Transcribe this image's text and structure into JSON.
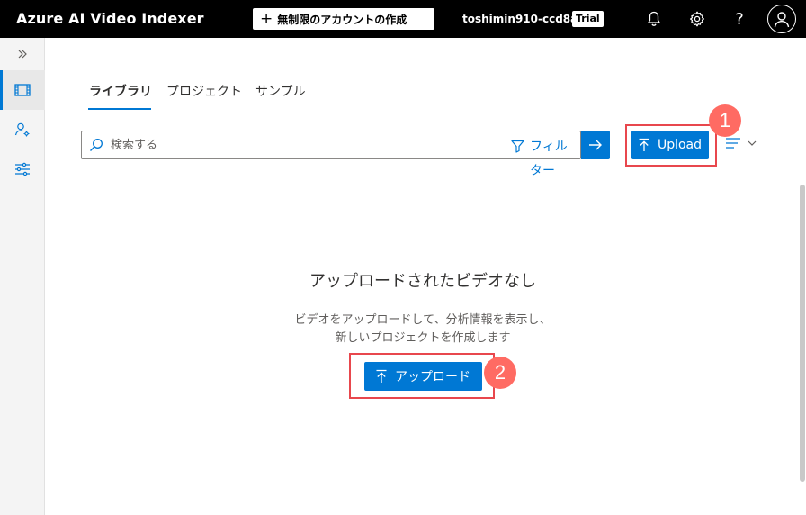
{
  "header": {
    "app_title": "Azure AI Video Indexer",
    "create_account_label": "無制限のアカウントの作成",
    "account_name": "toshimin910-ccd8ab",
    "trial_badge": "Trial",
    "icons": [
      "bell-icon",
      "gear-icon",
      "help-icon",
      "user-icon"
    ]
  },
  "sidebar": {
    "items": [
      {
        "name": "library",
        "icon": "film-icon",
        "active": true
      },
      {
        "name": "people",
        "icon": "people-settings-icon",
        "active": false
      },
      {
        "name": "customize",
        "icon": "sliders-icon",
        "active": false
      }
    ]
  },
  "tabs": [
    {
      "label": "ライブラリ",
      "active": true
    },
    {
      "label": "プロジェクト",
      "active": false
    },
    {
      "label": "サンプル",
      "active": false
    }
  ],
  "search": {
    "placeholder": "検索する",
    "value": "",
    "filter_label": "フィルター"
  },
  "toolbar": {
    "upload_label": "Upload"
  },
  "empty_state": {
    "title": "アップロードされたビデオなし",
    "line1": "ビデオをアップロードして、分析情報を表示し、",
    "line2": "新しいプロジェクトを作成します",
    "upload_label": "アップロード"
  },
  "annotations": {
    "step1": "1",
    "step2": "2"
  },
  "colors": {
    "accent": "#0078d4",
    "topbar": "#000000",
    "highlight": "#e8474d",
    "badge": "#ff6b63"
  }
}
